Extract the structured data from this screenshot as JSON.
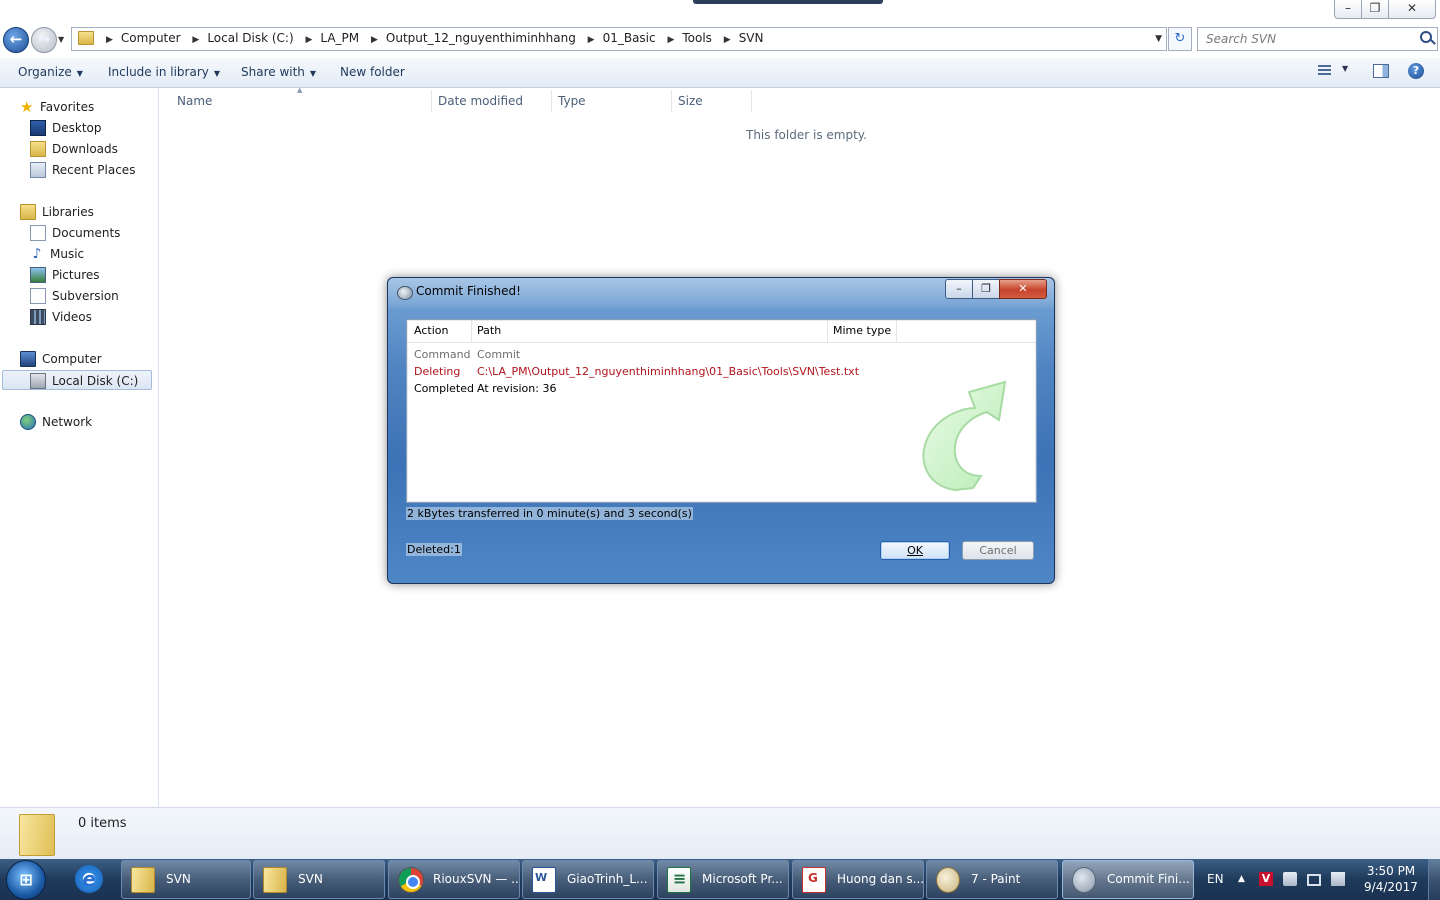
{
  "window": {
    "controls": {
      "minimize": "–",
      "maximize": "❐",
      "close": "✕"
    }
  },
  "address": {
    "breadcrumbs": [
      "Computer",
      "Local Disk (C:)",
      "LA_PM",
      "Output_12_nguyenthiminhhang",
      "01_Basic",
      "Tools",
      "SVN"
    ],
    "search_placeholder": "Search SVN"
  },
  "toolbar": {
    "organize": "Organize",
    "include_in_library": "Include in library",
    "share_with": "Share with",
    "new_folder": "New folder",
    "help": "?"
  },
  "sidebar": {
    "favorites": {
      "label": "Favorites",
      "items": [
        "Desktop",
        "Downloads",
        "Recent Places"
      ]
    },
    "libraries": {
      "label": "Libraries",
      "items": [
        "Documents",
        "Music",
        "Pictures",
        "Subversion",
        "Videos"
      ]
    },
    "computer": {
      "label": "Computer",
      "items": [
        "Local Disk (C:)"
      ]
    },
    "network": {
      "label": "Network"
    }
  },
  "content": {
    "columns": [
      "Name",
      "Date modified",
      "Type",
      "Size"
    ],
    "empty_message": "This folder is empty."
  },
  "status": {
    "item_count": "0 items"
  },
  "dialog": {
    "title": "Commit Finished!",
    "controls": {
      "minimize": "–",
      "maximize": "❐",
      "close": "✕"
    },
    "columns": [
      "Action",
      "Path",
      "Mime type"
    ],
    "rows": [
      {
        "action": "Command",
        "path": "Commit"
      },
      {
        "action": "Deleting",
        "path": "C:\\LA_PM\\Output_12_nguyenthiminhhang\\01_Basic\\Tools\\SVN\\Test.txt"
      },
      {
        "action": "Completed",
        "path": "At revision: 36"
      }
    ],
    "transfer_info": "2 kBytes transferred in 0 minute(s) and 3 second(s)",
    "deleted_count": "Deleted:1",
    "ok_label": "OK",
    "cancel_label": "Cancel"
  },
  "taskbar": {
    "start": "⊞",
    "ie": "e",
    "buttons": [
      "SVN",
      "SVN",
      "RiouxSVN — ...",
      "GiaoTrinh_L...",
      "Microsoft Pr...",
      "Huong dan s...",
      "7 - Paint",
      "Commit Fini..."
    ],
    "language": "EN",
    "tray_up": "▲",
    "tray_v": "V",
    "time": "3:50 PM",
    "date": "9/4/2017"
  },
  "colors": {
    "dialog_blue": "#4f84c2",
    "deleting_red": "#b0141c",
    "taskbar": "#1f3a5b"
  }
}
